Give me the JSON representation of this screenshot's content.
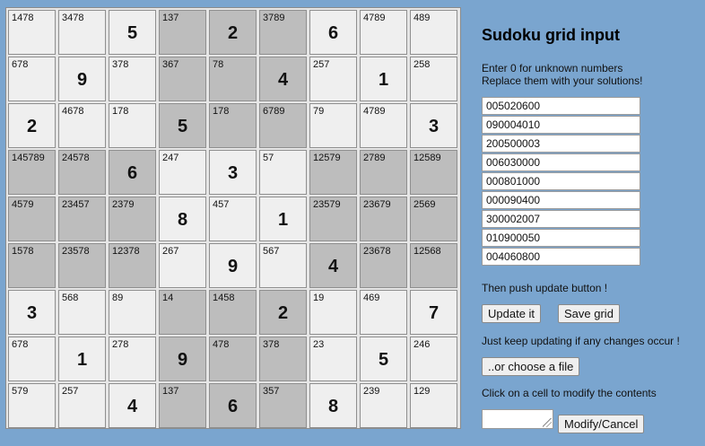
{
  "grid": [
    [
      {
        "c": "1478"
      },
      {
        "c": "3478"
      },
      {
        "v": "5"
      },
      {
        "c": "137"
      },
      {
        "v": "2"
      },
      {
        "c": "3789"
      },
      {
        "v": "6"
      },
      {
        "c": "4789"
      },
      {
        "c": "489"
      }
    ],
    [
      {
        "c": "678"
      },
      {
        "v": "9"
      },
      {
        "c": "378"
      },
      {
        "c": "367"
      },
      {
        "c": "78"
      },
      {
        "v": "4"
      },
      {
        "c": "257"
      },
      {
        "v": "1"
      },
      {
        "c": "258"
      }
    ],
    [
      {
        "v": "2"
      },
      {
        "c": "4678"
      },
      {
        "c": "178"
      },
      {
        "v": "5"
      },
      {
        "c": "178"
      },
      {
        "c": "6789"
      },
      {
        "c": "79"
      },
      {
        "c": "4789"
      },
      {
        "v": "3"
      }
    ],
    [
      {
        "c": "145789"
      },
      {
        "c": "24578"
      },
      {
        "v": "6"
      },
      {
        "c": "247"
      },
      {
        "v": "3"
      },
      {
        "c": "57"
      },
      {
        "c": "12579"
      },
      {
        "c": "2789"
      },
      {
        "c": "12589"
      }
    ],
    [
      {
        "c": "4579"
      },
      {
        "c": "23457"
      },
      {
        "c": "2379"
      },
      {
        "v": "8"
      },
      {
        "c": "457"
      },
      {
        "v": "1"
      },
      {
        "c": "23579"
      },
      {
        "c": "23679"
      },
      {
        "c": "2569"
      }
    ],
    [
      {
        "c": "1578"
      },
      {
        "c": "23578"
      },
      {
        "c": "12378"
      },
      {
        "c": "267"
      },
      {
        "v": "9"
      },
      {
        "c": "567"
      },
      {
        "v": "4"
      },
      {
        "c": "23678"
      },
      {
        "c": "12568"
      }
    ],
    [
      {
        "v": "3"
      },
      {
        "c": "568"
      },
      {
        "c": "89"
      },
      {
        "c": "14"
      },
      {
        "c": "1458"
      },
      {
        "v": "2"
      },
      {
        "c": "19"
      },
      {
        "c": "469"
      },
      {
        "v": "7"
      }
    ],
    [
      {
        "c": "678"
      },
      {
        "v": "1"
      },
      {
        "c": "278"
      },
      {
        "v": "9"
      },
      {
        "c": "478"
      },
      {
        "c": "378"
      },
      {
        "c": "23"
      },
      {
        "v": "5"
      },
      {
        "c": "246"
      }
    ],
    [
      {
        "c": "579"
      },
      {
        "c": "257"
      },
      {
        "v": "4"
      },
      {
        "c": "137"
      },
      {
        "v": "6"
      },
      {
        "c": "357"
      },
      {
        "v": "8"
      },
      {
        "c": "239"
      },
      {
        "c": "129"
      }
    ]
  ],
  "panel": {
    "title": "Sudoku grid input",
    "instructions": [
      "Enter 0 for unknown numbers",
      "Replace them with your solutions!"
    ],
    "rows": [
      "005020600",
      "090004010",
      "200500003",
      "006030000",
      "000801000",
      "000090400",
      "300002007",
      "010900050",
      "004060800"
    ],
    "push_text": "Then push update button !",
    "update_label": "Update it",
    "save_label": "Save grid",
    "keep_text": "Just keep updating if any changes occur !",
    "choose_label": "..or choose a file",
    "click_text": "Click on a cell to modify the contents",
    "modify_label": "Modify/Cancel"
  },
  "colors": {
    "background": "#7aa5cf",
    "cell_light": "#efefef",
    "cell_dark": "#bdbdbd"
  }
}
